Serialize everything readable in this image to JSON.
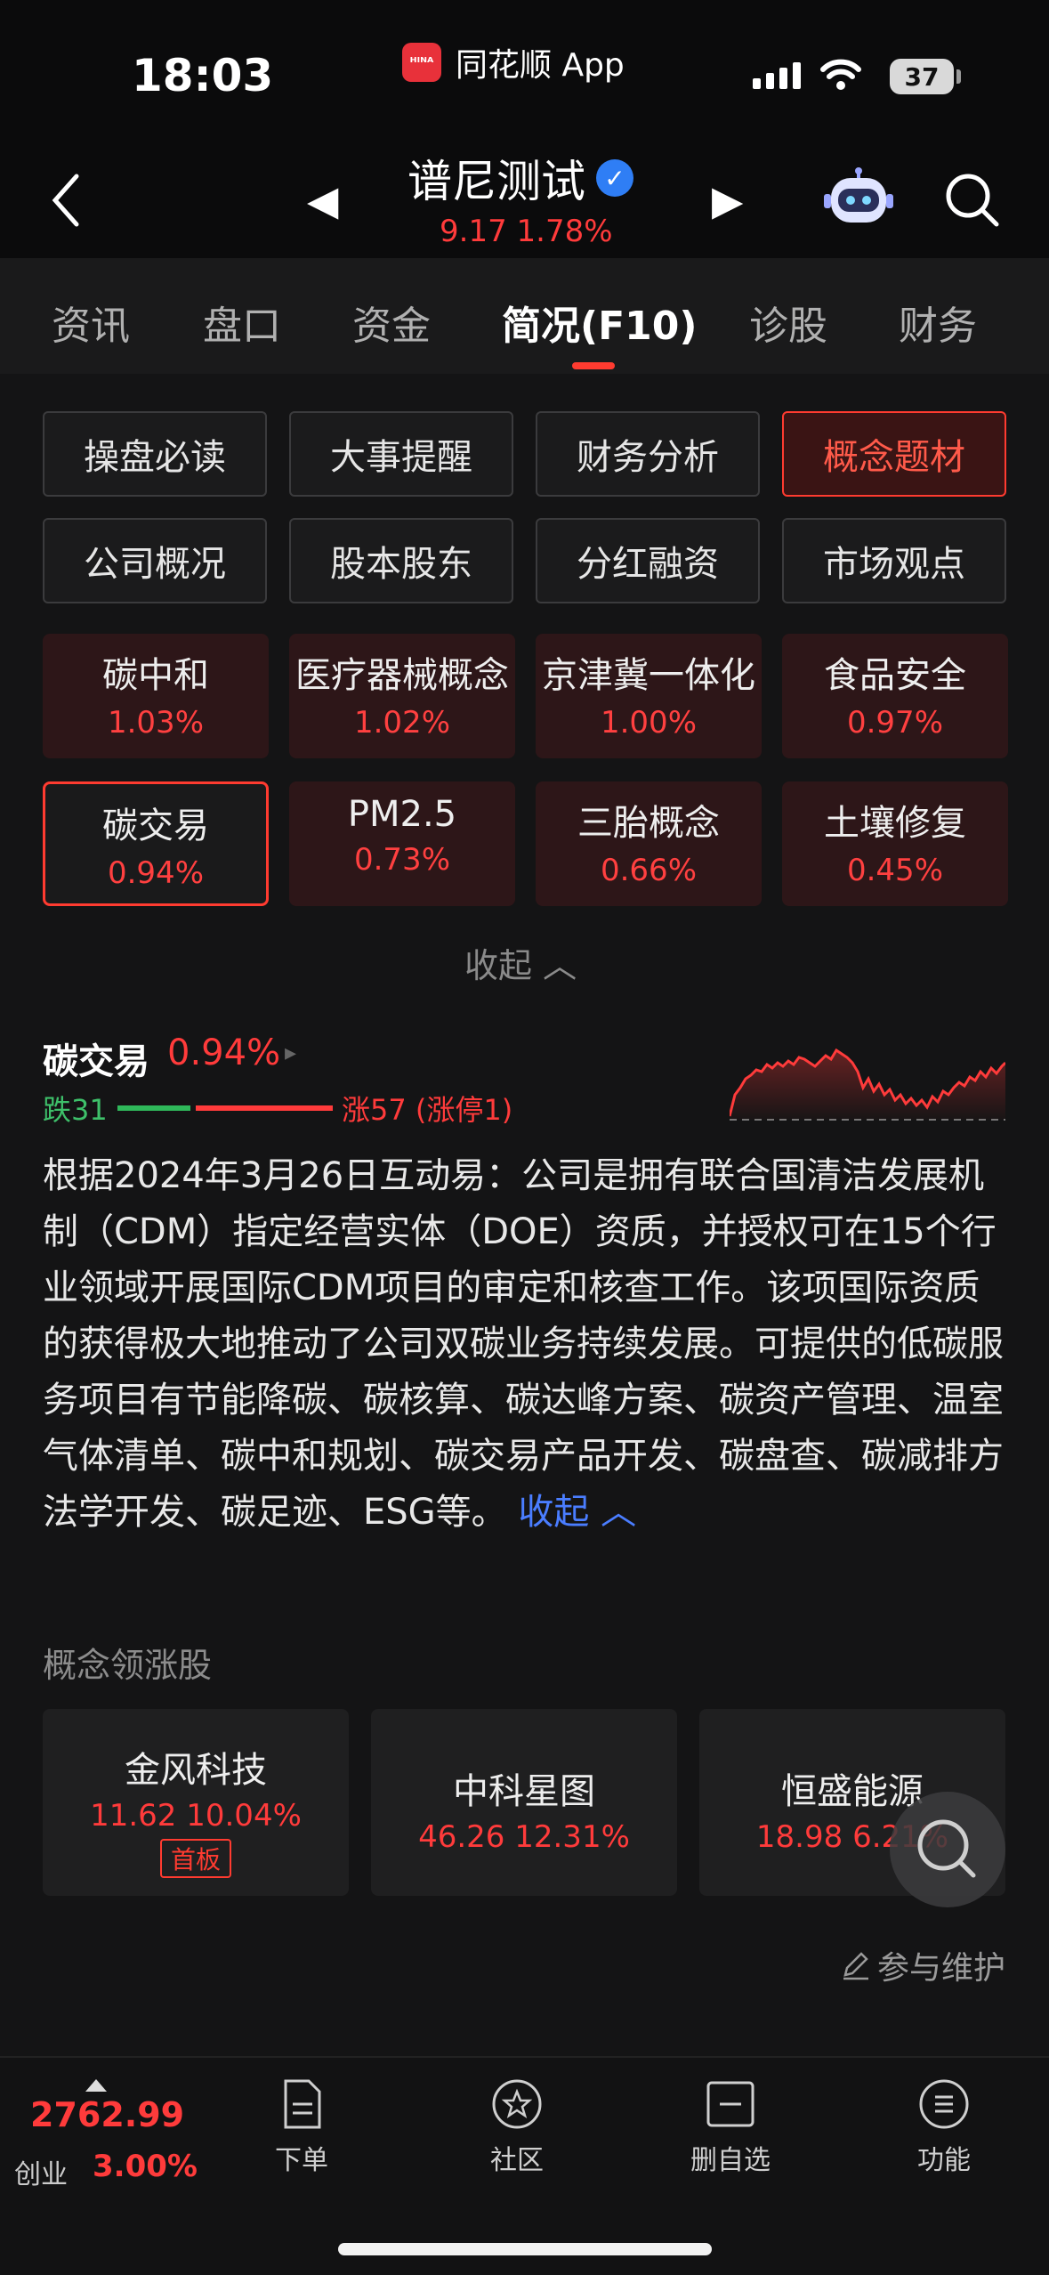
{
  "status": {
    "time": "18:03",
    "app_name": "同花顺 App",
    "app_logo_text": "ᴴᴵᴺᴬ",
    "battery": "37"
  },
  "header": {
    "stock_name": "谱尼测试",
    "verified_mark": "✓",
    "price_change": "9.17  1.78%",
    "prev_arrow": "◀",
    "next_arrow": "▶"
  },
  "tabs": [
    "资讯",
    "盘口",
    "资金",
    "简况(F10)",
    "诊股",
    "财务"
  ],
  "buttons": [
    "操盘必读",
    "大事提醒",
    "财务分析",
    "概念题材",
    "公司概况",
    "股本股东",
    "分红融资",
    "市场观点"
  ],
  "concepts": [
    {
      "name": "碳中和",
      "pct": "1.03%"
    },
    {
      "name": "医疗器械概念",
      "pct": "1.02%"
    },
    {
      "name": "京津冀一体化",
      "pct": "1.00%"
    },
    {
      "name": "食品安全",
      "pct": "0.97%"
    },
    {
      "name": "碳交易",
      "pct": "0.94%"
    },
    {
      "name": "PM2.5",
      "pct": "0.73%"
    },
    {
      "name": "三胎概念",
      "pct": "0.66%"
    },
    {
      "name": "土壤修复",
      "pct": "0.45%"
    }
  ],
  "collapse_label": "收起 ︿",
  "detail": {
    "name": "碳交易",
    "pct": "0.94%",
    "play": "▸",
    "fall": "跌31",
    "rise": "涨57 (涨停1)",
    "description": "根据2024年3月26日互动易：公司是拥有联合国清洁发展机制（CDM）指定经营实体（DOE）资质，并授权可在15个行业领域开展国际CDM项目的审定和核查工作。该项国际资质的获得极大地推动了公司双碳业务持续发展。可提供的低碳服务项目有节能降碳、碳核算、碳达峰方案、碳资产管理、温室气体清单、碳中和规划、碳交易产品开发、碳盘查、碳减排方法学开发、碳足迹、ESG等。",
    "more_label": "收起 ︿"
  },
  "leaders_title": "概念领涨股",
  "leaders": [
    {
      "name": "金风科技",
      "value": "11.62 10.04%",
      "tag": "首板"
    },
    {
      "name": "中科星图",
      "value": "46.26 12.31%",
      "tag": ""
    },
    {
      "name": "恒盛能源",
      "value": "18.98 6.21%",
      "tag": ""
    }
  ],
  "maintain_label": "参与维护",
  "bottom": {
    "index_value": "2762.99",
    "index_name": "创业",
    "index_pct": "3.00%",
    "nav": [
      "下单",
      "社区",
      "删自选",
      "功能"
    ]
  },
  "colors": {
    "up": "#ff3b3b",
    "down": "#3ec06a",
    "accent": "#ff3b30",
    "link": "#4a7dff"
  }
}
